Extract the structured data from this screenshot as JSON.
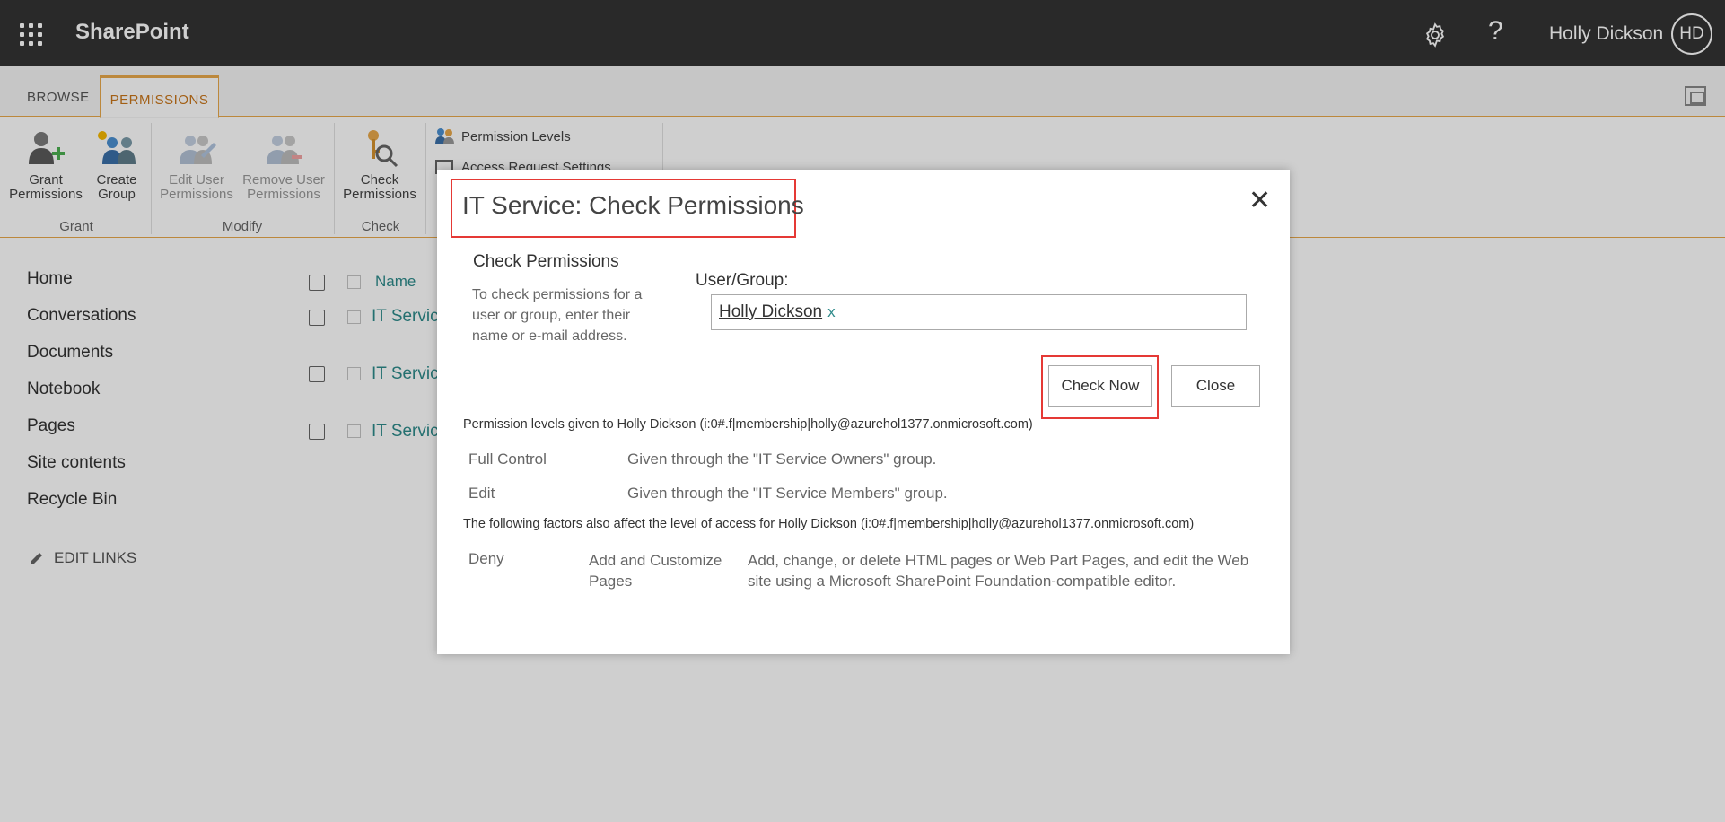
{
  "suitebar": {
    "brand": "SharePoint",
    "user_name": "Holly Dickson",
    "user_initials": "HD",
    "help_glyph": "?"
  },
  "ribbon": {
    "tabs": [
      {
        "label": "BROWSE",
        "active": false
      },
      {
        "label": "PERMISSIONS",
        "active": true
      }
    ],
    "buttons": {
      "grant_line1": "Grant",
      "grant_line2": "Permissions",
      "create_line1": "Create",
      "create_line2": "Group",
      "edit_line1": "Edit User",
      "edit_line2": "Permissions",
      "remove_line1": "Remove User",
      "remove_line2": "Permissions",
      "check_line1": "Check",
      "check_line2": "Permissions",
      "permission_levels": "Permission Levels",
      "access_request": "Access Request Settings"
    },
    "groups": {
      "grant": "Grant",
      "modify": "Modify",
      "check": "Check"
    }
  },
  "leftnav": {
    "items": [
      "Home",
      "Conversations",
      "Documents",
      "Notebook",
      "Pages",
      "Site contents",
      "Recycle Bin"
    ],
    "edit_links": "EDIT LINKS"
  },
  "list": {
    "column_name": "Name",
    "rows": [
      "IT Servic",
      "IT Servic",
      "IT Servic"
    ]
  },
  "dialog": {
    "title": "IT Service: Check Permissions",
    "close_glyph": "✕",
    "section_title": "Check Permissions",
    "section_desc": "To check permissions for a user or group, enter their name or e-mail address.",
    "user_group_label": "User/Group:",
    "user_value": "Holly Dickson",
    "user_remove": "x",
    "check_now_label": "Check Now",
    "close_label": "Close",
    "permission_heading": "Permission levels given to Holly Dickson (i:0#.f|membership|holly@azurehol1377.onmicrosoft.com)",
    "permissions": [
      {
        "level": "Full Control",
        "source": "Given through the \"IT Service Owners\" group."
      },
      {
        "level": "Edit",
        "source": "Given through the \"IT Service Members\" group."
      }
    ],
    "factors_heading": "The following factors also affect the level of access for Holly Dickson (i:0#.f|membership|holly@azurehol1377.onmicrosoft.com)",
    "factor": {
      "type": "Deny",
      "permission": "Add and Customize Pages",
      "description": "Add, change, or delete HTML pages or Web Part Pages, and edit the Web site using a Microsoft SharePoint Foundation-compatible editor."
    }
  },
  "colors": {
    "suitebar_bg": "#333333",
    "accent_orange": "#e8a84a",
    "link_teal": "#2d8a8a",
    "highlight_red": "#e53935"
  }
}
